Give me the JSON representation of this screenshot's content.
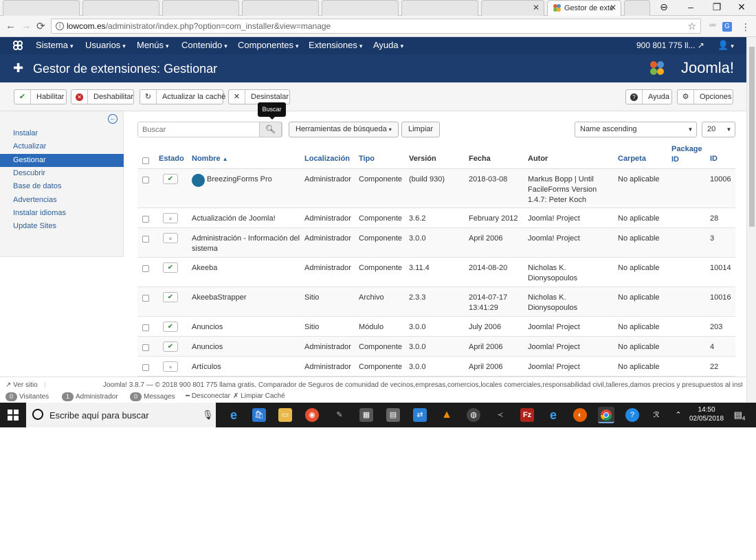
{
  "browser": {
    "tabs": [
      {
        "title": ""
      },
      {
        "title": ""
      },
      {
        "title": ""
      },
      {
        "title": ""
      },
      {
        "title": ""
      },
      {
        "title": ""
      },
      {
        "title": ""
      },
      {
        "title": "Gestor de exte"
      }
    ],
    "url_host": "lowcom.es",
    "url_path": "/administrator/index.php?option=com_installer&view=manage"
  },
  "joomla_nav": {
    "menus": [
      "Sistema",
      "Usuarios",
      "Menús",
      "Contenido",
      "Componentes",
      "Extensiones",
      "Ayuda"
    ],
    "right_phone": "900 801 775 ll..."
  },
  "header": {
    "title": "Gestor de extensiones: Gestionar",
    "logo_text": "Joomla!"
  },
  "toolbar": {
    "enable": "Habilitar",
    "disable": "Deshabilitar",
    "refresh_cache": "Actualizar la caché",
    "uninstall": "Desinstalar",
    "help": "Ayuda",
    "options": "Opciones"
  },
  "sidebar": {
    "items": [
      {
        "label": "Instalar"
      },
      {
        "label": "Actualizar"
      },
      {
        "label": "Gestionar"
      },
      {
        "label": "Descubrir"
      },
      {
        "label": "Base de datos"
      },
      {
        "label": "Advertencias"
      },
      {
        "label": "Instalar idiomas"
      },
      {
        "label": "Update Sites"
      }
    ],
    "active_index": 2
  },
  "filters": {
    "search_placeholder": "Buscar",
    "search_tooltip": "Buscar",
    "search_tools": "Herramientas de búsqueda",
    "clear": "Limpiar",
    "sort": "Name ascending",
    "limit": "20"
  },
  "table": {
    "headers": {
      "state": "Estado",
      "name": "Nombre",
      "location": "Localización",
      "type": "Tipo",
      "version": "Versión",
      "date": "Fecha",
      "author": "Autor",
      "folder": "Carpeta",
      "package_id": "Package ID",
      "id": "ID"
    },
    "rows": [
      {
        "state": "enabled",
        "name": "BreezingForms Pro",
        "location": "Administrador",
        "type": "Componente",
        "version": "(build 930)",
        "date": "2018-03-08",
        "author": "Markus Bopp | Until FacileForms Version 1.4.7: Peter Koch",
        "folder": "No aplicable",
        "package_id": "",
        "id": "10006"
      },
      {
        "state": "locked",
        "name": "Actualización de Joomla!",
        "location": "Administrador",
        "type": "Componente",
        "version": "3.6.2",
        "date": "February 2012",
        "author": "Joomla! Project",
        "folder": "No aplicable",
        "package_id": "",
        "id": "28"
      },
      {
        "state": "locked",
        "name": "Administración - Información del sistema",
        "location": "Administrador",
        "type": "Componente",
        "version": "3.0.0",
        "date": "April 2006",
        "author": "Joomla! Project",
        "folder": "No aplicable",
        "package_id": "",
        "id": "3"
      },
      {
        "state": "enabled",
        "name": "Akeeba",
        "location": "Administrador",
        "type": "Componente",
        "version": "3.11.4",
        "date": "2014-08-20",
        "author": "Nicholas K. Dionysopoulos",
        "folder": "No aplicable",
        "package_id": "",
        "id": "10014"
      },
      {
        "state": "enabled",
        "name": "AkeebaStrapper",
        "location": "Sitio",
        "type": "Archivo",
        "version": "2.3.3",
        "date": "2014-07-17 13:41:29",
        "author": "Nicholas K. Dionysopoulos",
        "folder": "No aplicable",
        "package_id": "",
        "id": "10016"
      },
      {
        "state": "enabled",
        "name": "Anuncios",
        "location": "Sitio",
        "type": "Módulo",
        "version": "3.0.0",
        "date": "July 2006",
        "author": "Joomla! Project",
        "folder": "No aplicable",
        "package_id": "",
        "id": "203"
      },
      {
        "state": "enabled",
        "name": "Anuncios",
        "location": "Administrador",
        "type": "Componente",
        "version": "3.0.0",
        "date": "April 2006",
        "author": "Joomla! Project",
        "folder": "No aplicable",
        "package_id": "",
        "id": "4"
      },
      {
        "state": "locked",
        "name": "Artículos",
        "location": "Administrador",
        "type": "Componente",
        "version": "3.0.0",
        "date": "April 2006",
        "author": "Joomla! Project",
        "folder": "No aplicable",
        "package_id": "",
        "id": "22"
      }
    ]
  },
  "status": {
    "view_site": "Ver sitio",
    "version_text": "Joomla! 3.8.7 — © 2018 900 801 775 llama gratis. Comparador de Seguros de comunidad de vecinos,empresas,comercios,locales comerciales,responsabilidad civil,talleres,damos precios y presupuestos al instante",
    "visitors_count": "0",
    "visitors_label": "Visitantes",
    "admins_count": "1",
    "admins_label": "Administrador",
    "messages_count": "0",
    "messages_label": "Messages",
    "logout": "Desconectar",
    "clear_cache": "Limpiar Caché"
  },
  "taskbar": {
    "search_text": "Escribe aquí para buscar",
    "time": "14:50",
    "date": "02/05/2018",
    "notifications": "4"
  },
  "colors": {
    "joomla_nav": "#1a3867",
    "joomla_header": "#1c3d6e",
    "accent": "#2a69b8",
    "enabled_green": "#378137"
  }
}
